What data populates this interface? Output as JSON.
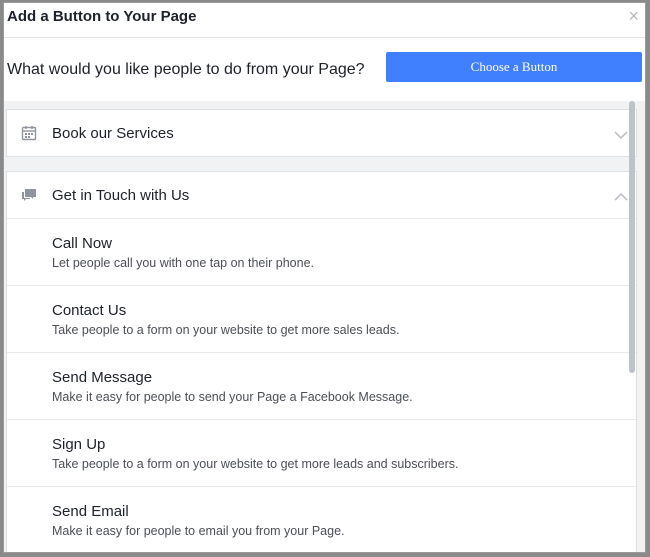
{
  "dialog": {
    "title": "Add a Button to Your Page",
    "close_glyph": "×"
  },
  "question": {
    "text": "What would you like people to do from your Page?",
    "button_label": "Choose a Button"
  },
  "sections": [
    {
      "title": "Book our Services",
      "icon": "calendar-icon",
      "expanded": false
    },
    {
      "title": "Get in Touch with Us",
      "icon": "chat-icon",
      "expanded": true,
      "options": [
        {
          "label": "Call Now",
          "description": "Let people call you with one tap on their phone."
        },
        {
          "label": "Contact Us",
          "description": "Take people to a form on your website to get more sales leads."
        },
        {
          "label": "Send Message",
          "description": "Make it easy for people to send your Page a Facebook Message."
        },
        {
          "label": "Sign Up",
          "description": "Take people to a form on your website to get more leads and subscribers."
        },
        {
          "label": "Send Email",
          "description": "Make it easy for people to email you from your Page."
        }
      ]
    }
  ],
  "colors": {
    "primary_button": "#4080ff",
    "background": "#f1f2f4",
    "icon_gray": "#90949c"
  }
}
